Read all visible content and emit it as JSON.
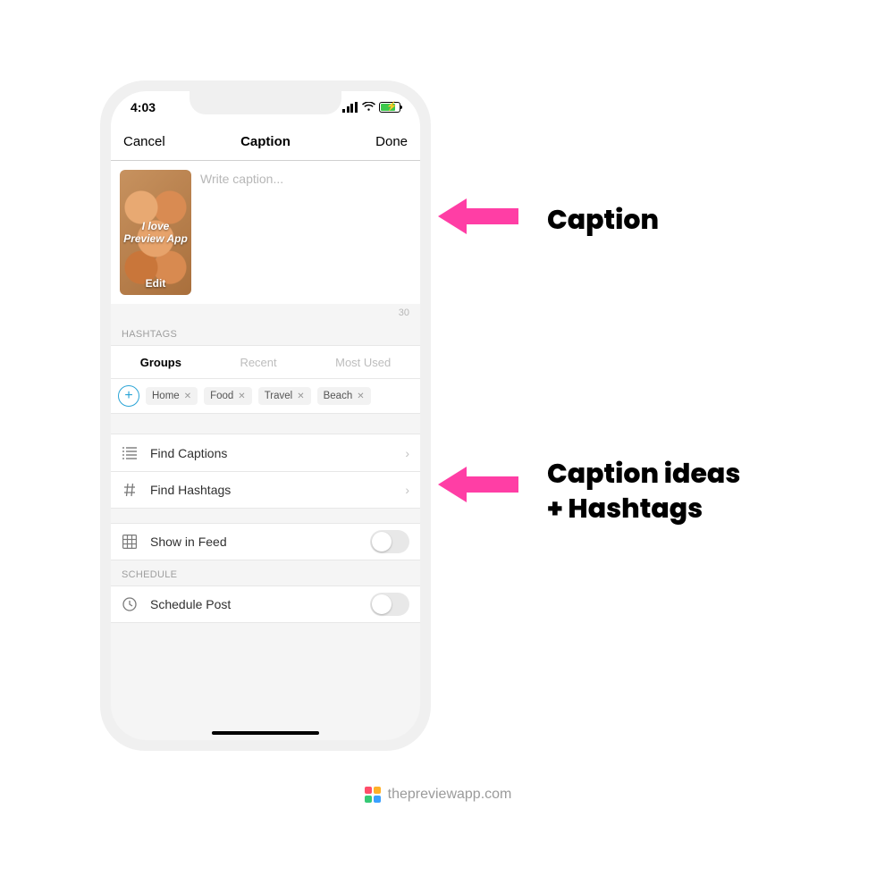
{
  "status": {
    "time": "4:03"
  },
  "nav": {
    "left": "Cancel",
    "title": "Caption",
    "right": "Done"
  },
  "caption": {
    "thumb_text": "I love Preview App",
    "thumb_edit": "Edit",
    "placeholder": "Write caption...",
    "counter": "30"
  },
  "hashtags": {
    "header": "HASHTAGS",
    "tabs": {
      "groups": "Groups",
      "recent": "Recent",
      "most_used": "Most Used"
    },
    "chips": [
      "Home",
      "Food",
      "Travel",
      "Beach"
    ]
  },
  "rows": {
    "find_captions": "Find Captions",
    "find_hashtags": "Find Hashtags",
    "show_in_feed": "Show in Feed",
    "schedule_header": "SCHEDULE",
    "schedule_post": "Schedule Post"
  },
  "callouts": {
    "caption": "Caption",
    "ideas_l1": "Caption ideas",
    "ideas_l2": "+ Hashtags"
  },
  "footer": {
    "url": "thepreviewapp.com"
  }
}
